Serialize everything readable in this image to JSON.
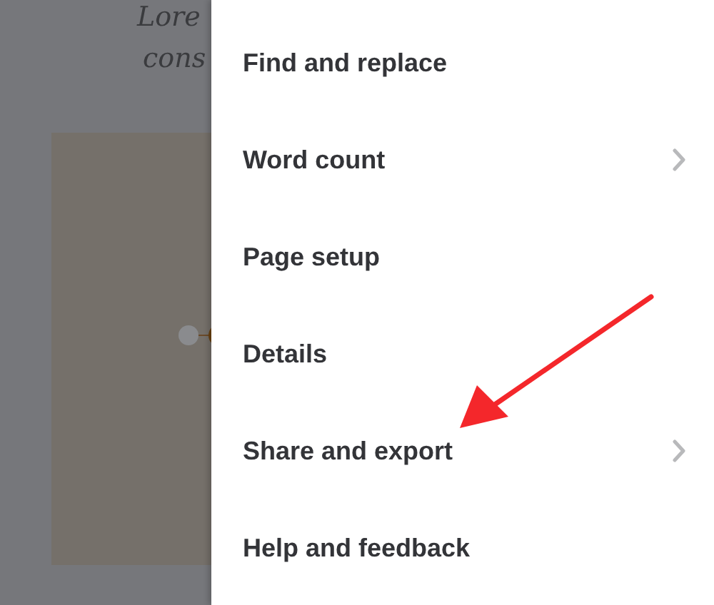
{
  "document": {
    "lines": [
      "Lore",
      "cons"
    ]
  },
  "menu": {
    "items": [
      {
        "label": "Find and replace",
        "submenu": false
      },
      {
        "label": "Word count",
        "submenu": true
      },
      {
        "label": "Page setup",
        "submenu": false
      },
      {
        "label": "Details",
        "submenu": false
      },
      {
        "label": "Share and export",
        "submenu": true
      },
      {
        "label": "Help and feedback",
        "submenu": false
      }
    ]
  }
}
